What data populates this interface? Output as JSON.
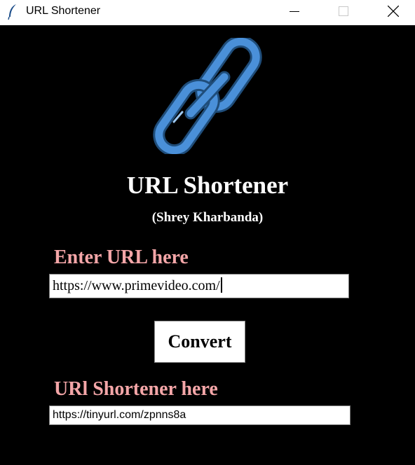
{
  "window": {
    "title": "URL Shortener",
    "app_icon": "feather-icon",
    "controls": [
      "minimize-icon",
      "maximize-icon",
      "close-icon"
    ]
  },
  "logo": {
    "icon": "chain-link-icon",
    "color": "#4a90d9"
  },
  "header": {
    "title": "URL Shortener",
    "author": "(Shrey Kharbanda)"
  },
  "form": {
    "input_label": "Enter URL here",
    "input_value": "https://www.primevideo.com/",
    "convert_label": "Convert",
    "output_label": "URl Shortener here",
    "output_value": "https://tinyurl.com/zpnns8a"
  },
  "colors": {
    "background": "#000000",
    "label": "#f4a6a8",
    "text": "#ffffff"
  }
}
